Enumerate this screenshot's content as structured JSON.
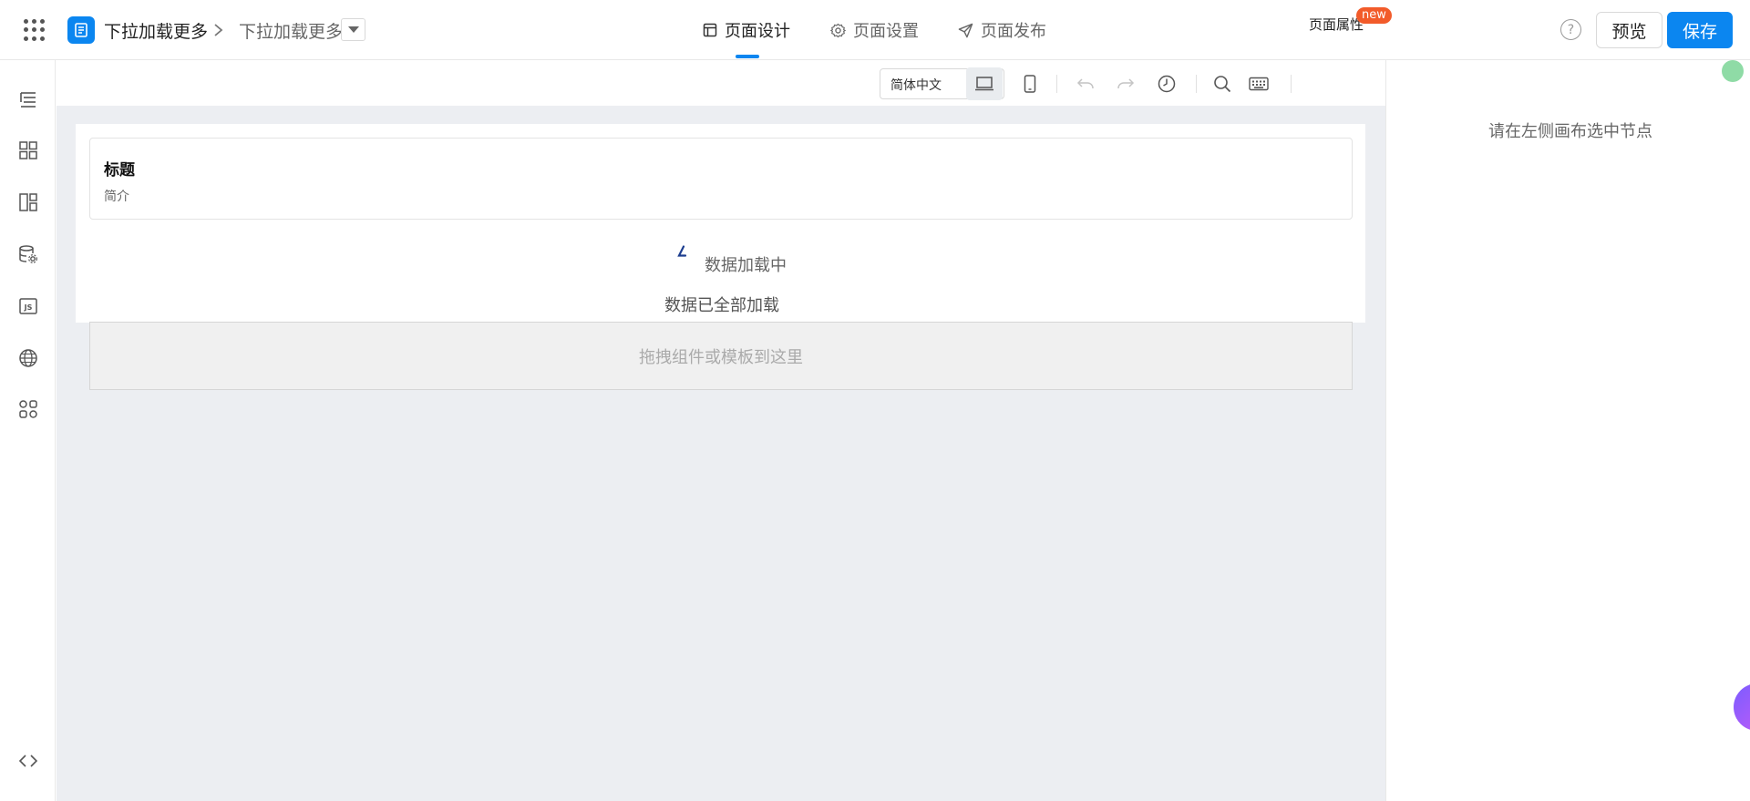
{
  "header": {
    "app_name": "下拉加载更多",
    "page_name": "下拉加载更多",
    "tabs": [
      {
        "label": "页面设计",
        "icon": "layout-icon",
        "active": true
      },
      {
        "label": "页面设置",
        "icon": "gear-icon",
        "active": false
      },
      {
        "label": "页面发布",
        "icon": "send-icon",
        "active": false
      }
    ],
    "help_glyph": "?",
    "preview_label": "预览",
    "save_label": "保存",
    "accent_color": "#0b86f0"
  },
  "sidebar": {
    "items": [
      {
        "icon": "outline-tree-icon"
      },
      {
        "icon": "components-grid-icon"
      },
      {
        "icon": "layout-panel-icon"
      },
      {
        "icon": "datasource-icon"
      },
      {
        "icon": "js-code-icon"
      },
      {
        "icon": "globe-icon"
      },
      {
        "icon": "plugins-icon"
      }
    ],
    "bottom_icon": "code-brackets-icon"
  },
  "toolbar": {
    "language": "简体中文",
    "page_attr_label": "页面属性",
    "new_badge": "new"
  },
  "canvas": {
    "card_title": "标题",
    "card_desc": "简介",
    "loading_text": "数据加载中",
    "all_loaded_text": "数据已全部加载",
    "dropzone_text": "拖拽组件或模板到这里"
  },
  "right_panel": {
    "empty_hint": "请在左侧画布选中节点"
  }
}
